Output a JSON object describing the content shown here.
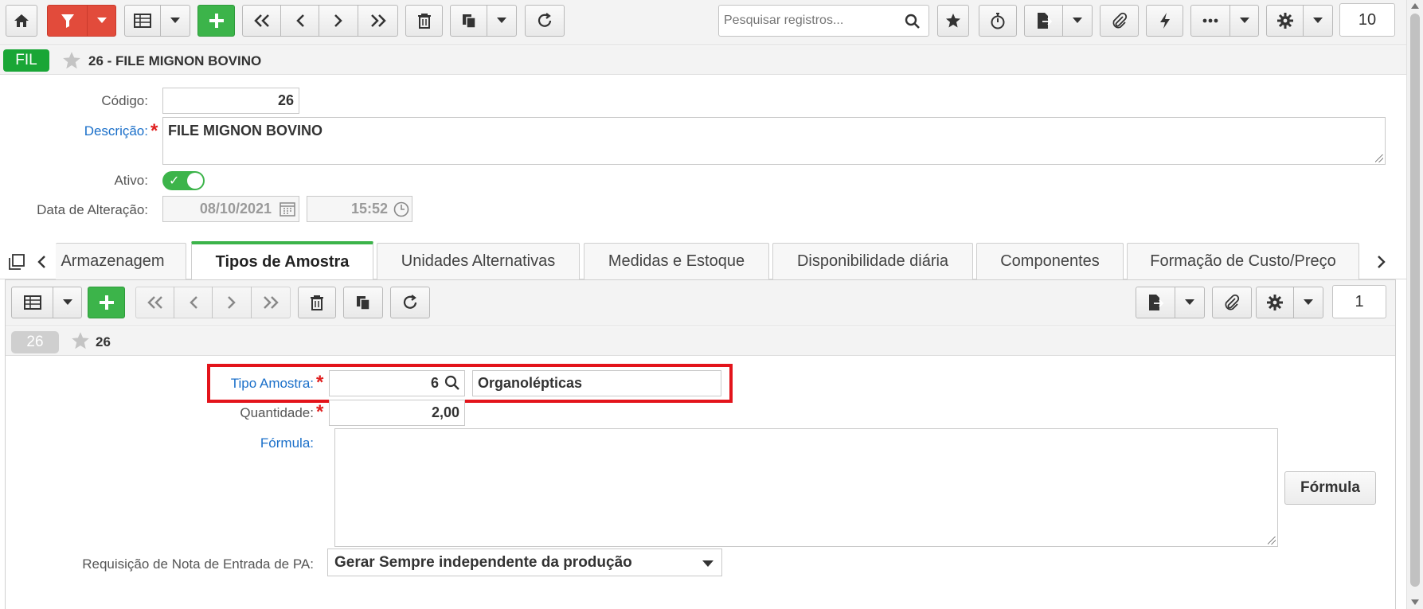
{
  "toolbar": {
    "search_placeholder": "Pesquisar registros...",
    "record_count": "10"
  },
  "record": {
    "badge": "FIL",
    "title": "26 - FILE MIGNON BOVINO"
  },
  "form": {
    "codigo_label": "Código:",
    "codigo_value": "26",
    "descricao_label": "Descrição:",
    "descricao_value": "FILE MIGNON BOVINO",
    "ativo_label": "Ativo:",
    "data_alteracao_label": "Data de Alteração:",
    "data_value": "08/10/2021",
    "hora_value": "15:52"
  },
  "tabs": [
    {
      "label": "Armazenagem"
    },
    {
      "label": "Tipos de Amostra",
      "active": true
    },
    {
      "label": "Unidades Alternativas"
    },
    {
      "label": "Medidas e Estoque"
    },
    {
      "label": "Disponibilidade diária"
    },
    {
      "label": "Componentes"
    },
    {
      "label": "Formação de Custo/Preço"
    }
  ],
  "subtoolbar": {
    "record_count": "1"
  },
  "subrecord": {
    "badge": "26",
    "title": "26"
  },
  "subform": {
    "tipo_amostra_label": "Tipo Amostra:",
    "tipo_amostra_code": "6",
    "tipo_amostra_desc": "Organolépticas",
    "quantidade_label": "Quantidade:",
    "quantidade_value": "2,00",
    "formula_label": "Fórmula:",
    "formula_button": "Fórmula",
    "requisicao_label": "Requisição de Nota de Entrada de PA:",
    "requisicao_value": "Gerar Sempre independente da produção"
  },
  "colors": {
    "accent_green": "#3cb44a",
    "filter_red": "#e24b3b",
    "label_blue": "#1a6fc9",
    "highlight_red": "#e3141b"
  }
}
